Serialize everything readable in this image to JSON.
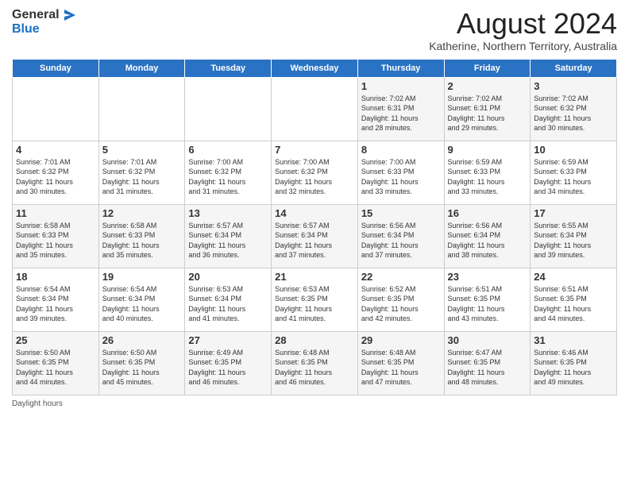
{
  "header": {
    "logo_general": "General",
    "logo_blue": "Blue",
    "main_title": "August 2024",
    "subtitle": "Katherine, Northern Territory, Australia"
  },
  "days_of_week": [
    "Sunday",
    "Monday",
    "Tuesday",
    "Wednesday",
    "Thursday",
    "Friday",
    "Saturday"
  ],
  "weeks": [
    [
      {
        "day": "",
        "info": ""
      },
      {
        "day": "",
        "info": ""
      },
      {
        "day": "",
        "info": ""
      },
      {
        "day": "",
        "info": ""
      },
      {
        "day": "1",
        "info": "Sunrise: 7:02 AM\nSunset: 6:31 PM\nDaylight: 11 hours\nand 28 minutes."
      },
      {
        "day": "2",
        "info": "Sunrise: 7:02 AM\nSunset: 6:31 PM\nDaylight: 11 hours\nand 29 minutes."
      },
      {
        "day": "3",
        "info": "Sunrise: 7:02 AM\nSunset: 6:32 PM\nDaylight: 11 hours\nand 30 minutes."
      }
    ],
    [
      {
        "day": "4",
        "info": "Sunrise: 7:01 AM\nSunset: 6:32 PM\nDaylight: 11 hours\nand 30 minutes."
      },
      {
        "day": "5",
        "info": "Sunrise: 7:01 AM\nSunset: 6:32 PM\nDaylight: 11 hours\nand 31 minutes."
      },
      {
        "day": "6",
        "info": "Sunrise: 7:00 AM\nSunset: 6:32 PM\nDaylight: 11 hours\nand 31 minutes."
      },
      {
        "day": "7",
        "info": "Sunrise: 7:00 AM\nSunset: 6:32 PM\nDaylight: 11 hours\nand 32 minutes."
      },
      {
        "day": "8",
        "info": "Sunrise: 7:00 AM\nSunset: 6:33 PM\nDaylight: 11 hours\nand 33 minutes."
      },
      {
        "day": "9",
        "info": "Sunrise: 6:59 AM\nSunset: 6:33 PM\nDaylight: 11 hours\nand 33 minutes."
      },
      {
        "day": "10",
        "info": "Sunrise: 6:59 AM\nSunset: 6:33 PM\nDaylight: 11 hours\nand 34 minutes."
      }
    ],
    [
      {
        "day": "11",
        "info": "Sunrise: 6:58 AM\nSunset: 6:33 PM\nDaylight: 11 hours\nand 35 minutes."
      },
      {
        "day": "12",
        "info": "Sunrise: 6:58 AM\nSunset: 6:33 PM\nDaylight: 11 hours\nand 35 minutes."
      },
      {
        "day": "13",
        "info": "Sunrise: 6:57 AM\nSunset: 6:34 PM\nDaylight: 11 hours\nand 36 minutes."
      },
      {
        "day": "14",
        "info": "Sunrise: 6:57 AM\nSunset: 6:34 PM\nDaylight: 11 hours\nand 37 minutes."
      },
      {
        "day": "15",
        "info": "Sunrise: 6:56 AM\nSunset: 6:34 PM\nDaylight: 11 hours\nand 37 minutes."
      },
      {
        "day": "16",
        "info": "Sunrise: 6:56 AM\nSunset: 6:34 PM\nDaylight: 11 hours\nand 38 minutes."
      },
      {
        "day": "17",
        "info": "Sunrise: 6:55 AM\nSunset: 6:34 PM\nDaylight: 11 hours\nand 39 minutes."
      }
    ],
    [
      {
        "day": "18",
        "info": "Sunrise: 6:54 AM\nSunset: 6:34 PM\nDaylight: 11 hours\nand 39 minutes."
      },
      {
        "day": "19",
        "info": "Sunrise: 6:54 AM\nSunset: 6:34 PM\nDaylight: 11 hours\nand 40 minutes."
      },
      {
        "day": "20",
        "info": "Sunrise: 6:53 AM\nSunset: 6:34 PM\nDaylight: 11 hours\nand 41 minutes."
      },
      {
        "day": "21",
        "info": "Sunrise: 6:53 AM\nSunset: 6:35 PM\nDaylight: 11 hours\nand 41 minutes."
      },
      {
        "day": "22",
        "info": "Sunrise: 6:52 AM\nSunset: 6:35 PM\nDaylight: 11 hours\nand 42 minutes."
      },
      {
        "day": "23",
        "info": "Sunrise: 6:51 AM\nSunset: 6:35 PM\nDaylight: 11 hours\nand 43 minutes."
      },
      {
        "day": "24",
        "info": "Sunrise: 6:51 AM\nSunset: 6:35 PM\nDaylight: 11 hours\nand 44 minutes."
      }
    ],
    [
      {
        "day": "25",
        "info": "Sunrise: 6:50 AM\nSunset: 6:35 PM\nDaylight: 11 hours\nand 44 minutes."
      },
      {
        "day": "26",
        "info": "Sunrise: 6:50 AM\nSunset: 6:35 PM\nDaylight: 11 hours\nand 45 minutes."
      },
      {
        "day": "27",
        "info": "Sunrise: 6:49 AM\nSunset: 6:35 PM\nDaylight: 11 hours\nand 46 minutes."
      },
      {
        "day": "28",
        "info": "Sunrise: 6:48 AM\nSunset: 6:35 PM\nDaylight: 11 hours\nand 46 minutes."
      },
      {
        "day": "29",
        "info": "Sunrise: 6:48 AM\nSunset: 6:35 PM\nDaylight: 11 hours\nand 47 minutes."
      },
      {
        "day": "30",
        "info": "Sunrise: 6:47 AM\nSunset: 6:35 PM\nDaylight: 11 hours\nand 48 minutes."
      },
      {
        "day": "31",
        "info": "Sunrise: 6:46 AM\nSunset: 6:35 PM\nDaylight: 11 hours\nand 49 minutes."
      }
    ]
  ],
  "footer": {
    "daylight_label": "Daylight hours"
  }
}
